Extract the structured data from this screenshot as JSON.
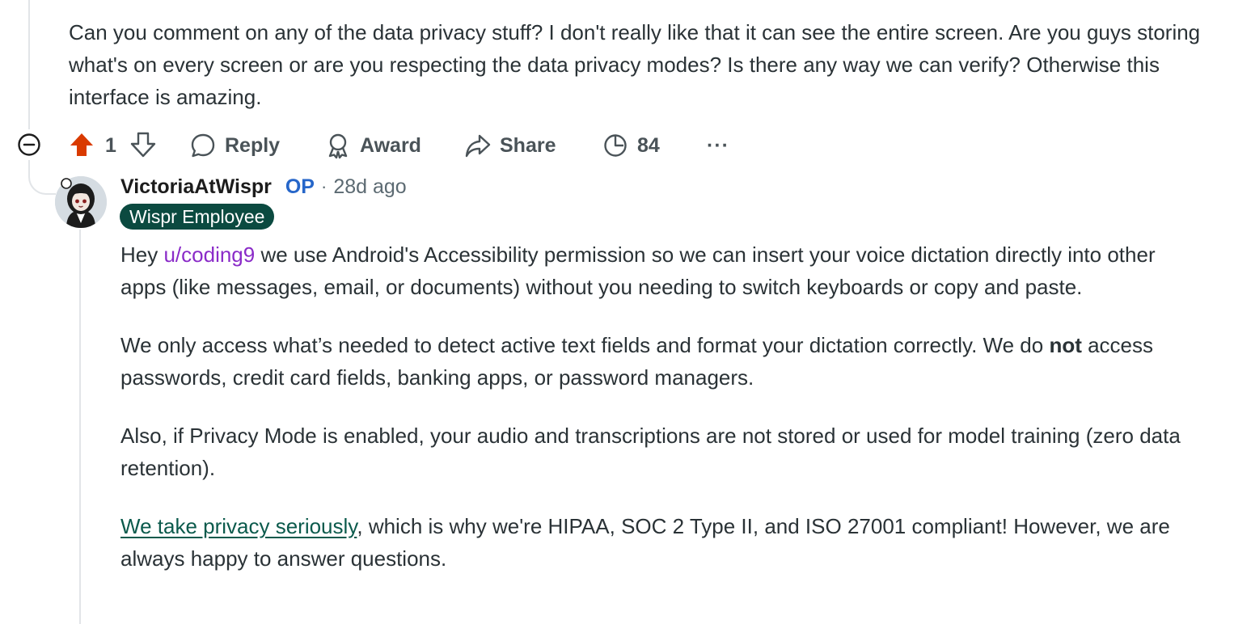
{
  "parent_comment": {
    "text": "Can you comment on any of the data privacy stuff? I don't really like that it can see the entire screen. Are you guys storing what's on every screen or are you respecting the data privacy modes? Is there any way we can verify? Otherwise this interface is amazing."
  },
  "actions": {
    "vote_count": "1",
    "reply_label": "Reply",
    "award_label": "Award",
    "share_label": "Share",
    "insights_count": "84",
    "more_label": "···"
  },
  "reply": {
    "author": "VictoriaAtWispr",
    "op_tag": "OP",
    "separator": "·",
    "age": "28d ago",
    "flair": "Wispr Employee",
    "p1_prefix": "Hey ",
    "p1_mention": "u/coding9",
    "p1_rest": " we use Android's Accessibility permission so we can insert your voice dictation directly into other apps (like messages, email, or documents) without you needing to switch keyboards or copy and paste.",
    "p2_start": "We only access what’s needed to detect active text fields and format your dictation correctly. We do ",
    "p2_bold": "not",
    "p2_rest": " access passwords, credit card fields, banking apps, or password managers.",
    "p3": "Also, if Privacy Mode is enabled, your audio and transcriptions are not stored or used for model training (zero data retention).",
    "p4_link": "We take privacy seriously",
    "p4_rest": ", which is why we're HIPAA, SOC 2 Type II, and ISO 27001 compliant! However, we are always happy to answer questions."
  },
  "colors": {
    "upvote_active": "#d93a00",
    "op_blue": "#2666c9",
    "flair_bg": "#0b4a40",
    "mention_purple": "#8a2bc8",
    "link_green": "#0b5a4c"
  },
  "icons": [
    "collapse-icon",
    "upvote-icon",
    "downvote-icon",
    "reply-icon",
    "award-icon",
    "share-icon",
    "insights-icon",
    "more-icon"
  ]
}
